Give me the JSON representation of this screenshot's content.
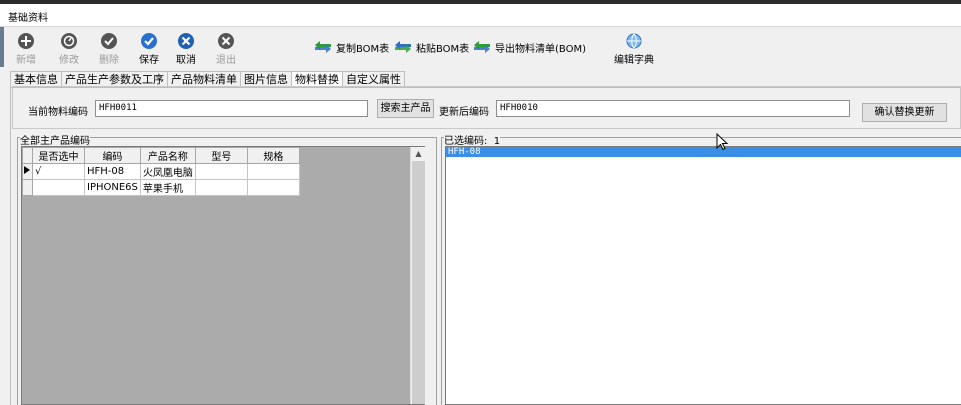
{
  "window": {
    "title": "基础资料"
  },
  "toolbar": {
    "buttons": [
      {
        "label": "新增",
        "icon": "plus-circle-icon",
        "enabled": false
      },
      {
        "label": "修改",
        "icon": "edit-circle-icon",
        "enabled": false
      },
      {
        "label": "删除",
        "icon": "delete-circle-icon",
        "enabled": false
      },
      {
        "label": "保存",
        "icon": "check-circle-icon",
        "enabled": true
      },
      {
        "label": "取消",
        "icon": "x-circle-icon",
        "enabled": true
      },
      {
        "label": "退出",
        "icon": "exit-circle-icon",
        "enabled": false
      }
    ],
    "copy_bom": "复制BOM表",
    "paste_bom": "粘贴BOM表",
    "export_bom": "导出物料清单(BOM)",
    "edit_dict": "编辑字典"
  },
  "tabs": [
    {
      "label": "基本信息",
      "active": false
    },
    {
      "label": "产品生产参数及工序",
      "active": false
    },
    {
      "label": "产品物料清单",
      "active": false
    },
    {
      "label": "图片信息",
      "active": false
    },
    {
      "label": "物料替换",
      "active": true
    },
    {
      "label": "自定义属性",
      "active": false
    }
  ],
  "form": {
    "current_label": "当前物料编码",
    "current_value": "HFH0011",
    "search_button": "搜索主产品",
    "updated_label": "更新后编码",
    "updated_value": "HFH0010",
    "confirm_button": "确认替换更新"
  },
  "left_group": {
    "title": "全部主产品编码",
    "columns": [
      "是否选中",
      "编码",
      "产品名称",
      "型号",
      "规格"
    ],
    "rows": [
      {
        "selected": "√",
        "code": "HFH-08",
        "name": "火凤凰电脑",
        "model": "",
        "spec": ""
      },
      {
        "selected": "",
        "code": "IPHONE6S",
        "name": "苹果手机",
        "model": "",
        "spec": ""
      }
    ]
  },
  "right_group": {
    "title": "已选编码:",
    "count": "1",
    "items": [
      "HFH-08"
    ]
  },
  "colors": {
    "selection": "#3b8ee6",
    "toolbar_arrow_green": "#2e9d3a",
    "toolbar_arrow_blue": "#2f6fc4"
  }
}
